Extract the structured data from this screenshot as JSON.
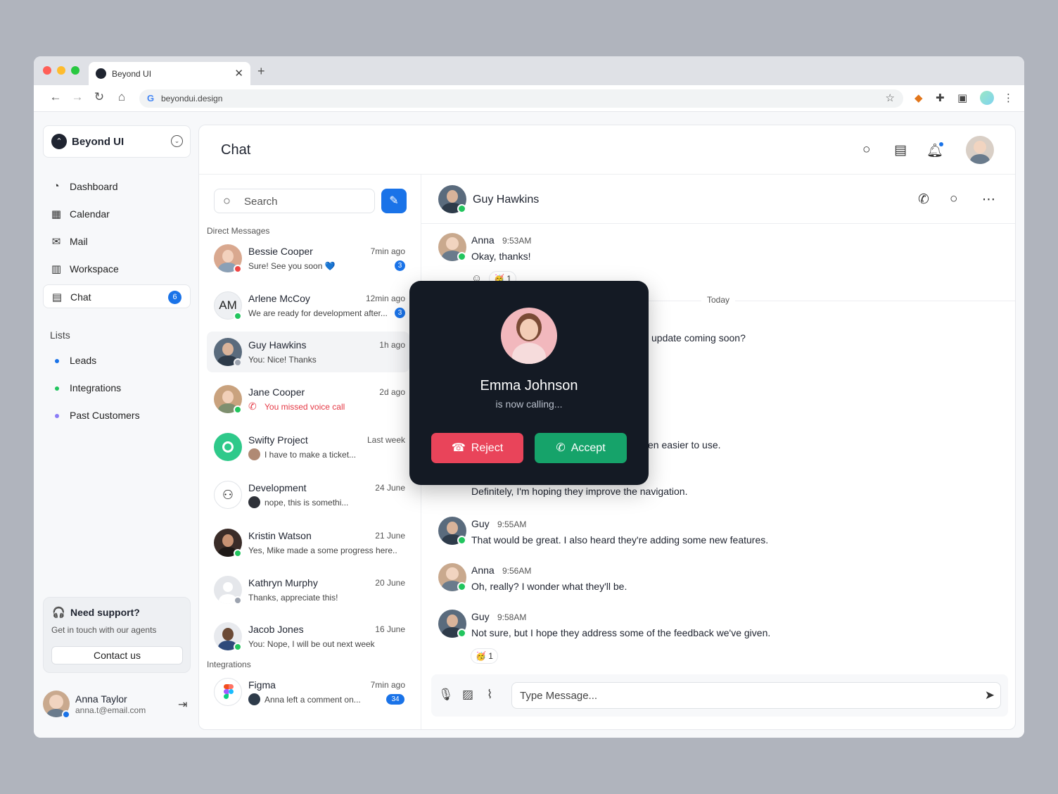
{
  "browser": {
    "tab_title": "Beyond UI",
    "tab_close": "✕",
    "new_tab": "+",
    "url": "beyondui.design",
    "dots": [
      "#ff5f57",
      "#febc2e",
      "#28c840"
    ]
  },
  "sidebar": {
    "workspace_name": "Beyond UI",
    "nav": [
      {
        "label": "Dashboard",
        "icon": "dashboard-icon"
      },
      {
        "label": "Calendar",
        "icon": "calendar-icon"
      },
      {
        "label": "Mail",
        "icon": "mail-icon"
      },
      {
        "label": "Workspace",
        "icon": "workspace-icon"
      },
      {
        "label": "Chat",
        "icon": "chat-icon",
        "badge": "6",
        "active": true
      }
    ],
    "lists_heading": "Lists",
    "lists": [
      {
        "label": "Leads",
        "color": "#1a73e8"
      },
      {
        "label": "Integrations",
        "color": "#22c55e"
      },
      {
        "label": "Past Customers",
        "color": "#8b7cf6"
      }
    ],
    "support": {
      "title": "Need support?",
      "desc": "Get in touch with our agents",
      "button": "Contact us"
    },
    "user": {
      "name": "Anna Taylor",
      "email": "anna.t@email.com"
    }
  },
  "header": {
    "title": "Chat"
  },
  "conversations": {
    "search_placeholder": "Search",
    "direct_heading": "Direct Messages",
    "integrations_heading": "Integrations",
    "items": [
      {
        "name": "Bessie Cooper",
        "time": "7min ago",
        "preview": "Sure! See you soon 💙",
        "badge": "3",
        "status": "#ef4444"
      },
      {
        "name": "Arlene McCoy",
        "time": "12min ago",
        "preview": "We are ready for development after...",
        "badge": "3",
        "status": "#22c55e",
        "initials": "AM"
      },
      {
        "name": "Guy Hawkins",
        "time": "1h ago",
        "preview": "You: Nice! Thanks",
        "status": "#9ca3af"
      },
      {
        "name": "Jane Cooper",
        "time": "2d ago",
        "preview": "You missed voice call",
        "status": "#22c55e"
      },
      {
        "name": "Swifty Project",
        "time": "Last week",
        "preview": "I have to make a ticket..."
      },
      {
        "name": "Development",
        "time": "24 June",
        "preview": "nope, this is somethi..."
      },
      {
        "name": "Kristin Watson",
        "time": "21 June",
        "preview": "Yes, Mike made a some progress here...",
        "status": "#22c55e"
      },
      {
        "name": "Kathryn Murphy",
        "time": "20 June",
        "preview": "Thanks, appreciate this!",
        "status": "#9ca3af"
      },
      {
        "name": "Jacob Jones",
        "time": "16 June",
        "preview": "You: Nope, I will be out next week",
        "status": "#22c55e"
      },
      {
        "name": "Figma",
        "time": "7min ago",
        "preview": "Anna left a comment on...",
        "badge": "34"
      }
    ]
  },
  "chat": {
    "contact": "Guy Hawkins",
    "today": "Today",
    "messages": [
      {
        "name": "Anna",
        "time": "9:53AM",
        "text": "Okay, thanks!"
      },
      {
        "name": "Guy",
        "time": "9:55AM",
        "text": "That would be great. I also heard they're adding some new features."
      },
      {
        "name": "Anna",
        "time": "9:56AM",
        "text": "Oh, really? I wonder what they'll be."
      },
      {
        "name": "Guy",
        "time": "9:58AM",
        "text": "Not sure, but I hope they address some of the feedback we've given."
      }
    ],
    "partial_1": "update coming soon?",
    "partial_2": "en easier to use.",
    "partial_3": "Definitely, I'm hoping they improve the navigation.",
    "reaction_top": "🥳 1",
    "reaction_bottom": "🥳 1",
    "composer_placeholder": "Type Message..."
  },
  "call": {
    "name": "Emma Johnson",
    "status": "is now calling...",
    "reject": "Reject",
    "accept": "Accept"
  }
}
